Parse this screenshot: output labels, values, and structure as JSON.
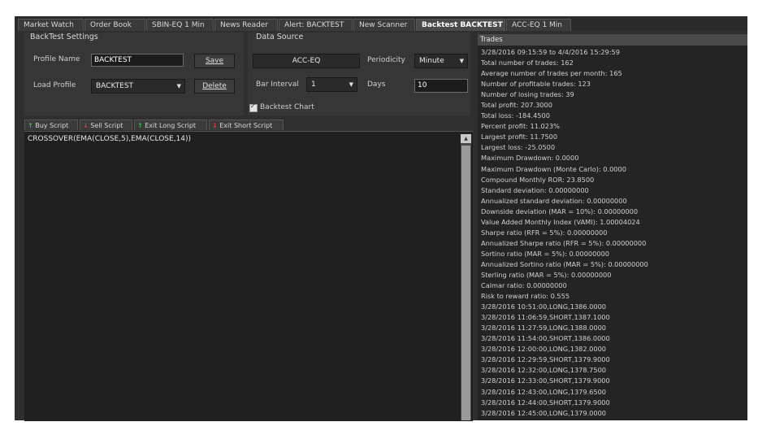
{
  "tabs": [
    {
      "label": "Market Watch"
    },
    {
      "label": "Order Book"
    },
    {
      "label": "SBIN-EQ 1 Min"
    },
    {
      "label": "News Reader"
    },
    {
      "label": "Alert: BACKTEST"
    },
    {
      "label": "New Scanner"
    },
    {
      "label": "Backtest BACKTEST",
      "close": "✕",
      "active": true
    },
    {
      "label": "ACC-EQ 1 Min"
    }
  ],
  "backtest_settings": {
    "title": "BackTest Settings",
    "profile_name_label": "Profile Name",
    "profile_name_value": "BACKTEST",
    "save_label": "Save",
    "load_profile_label": "Load Profile",
    "load_profile_value": "BACKTEST",
    "delete_label": "Delete"
  },
  "data_source": {
    "title": "Data Source",
    "symbol": "ACC-EQ",
    "periodicity_label": "Periodicity",
    "periodicity_value": "Minute",
    "bar_interval_label": "Bar Interval",
    "bar_interval_value": "1",
    "days_label": "Days",
    "days_value": "10",
    "backtest_chart_label": "Backtest Chart",
    "backtest_chart_checked": true
  },
  "script_tabs": [
    {
      "label": "Buy Script",
      "arrow": "↑",
      "arrow_color": "green"
    },
    {
      "label": "Sell Script",
      "arrow": "↓",
      "arrow_color": "red"
    },
    {
      "label": "Exit Long Script",
      "arrow": "↑",
      "arrow_color": "green"
    },
    {
      "label": "Exit Short Script",
      "arrow": "↓",
      "arrow_color": "red"
    }
  ],
  "script_code": "CROSSOVER(EMA(CLOSE,5),EMA(CLOSE,14))",
  "trades": {
    "header": "Trades",
    "lines": [
      "3/28/2016 09:15:59 to 4/4/2016 15:29:59",
      "Total number of trades: 162",
      "Average number of trades per month: 165",
      "Number of profitable trades: 123",
      "Number of losing trades: 39",
      "Total profit: 207.3000",
      "Total loss: -184.4500",
      "Percent profit: 11.023%",
      "Largest profit: 11.7500",
      "Largest loss: -25.0500",
      "Maximum Drawdown: 0.0000",
      "Maximum Drawdown (Monte Carlo): 0.0000",
      "Compound Monthly ROR: 23.8500",
      "Standard deviation: 0.00000000",
      "Annualized standard deviation: 0.00000000",
      "Downside deviation (MAR = 10%): 0.00000000",
      "Value Added Monthly Index (VAMI): 1.00004024",
      "Sharpe ratio (RFR = 5%): 0.00000000",
      "Annualized Sharpe ratio (RFR = 5%): 0.00000000",
      "Sortino ratio (MAR = 5%): 0.00000000",
      "Annualized Sortino ratio (MAR = 5%): 0.00000000",
      "Sterling ratio (MAR = 5%): 0.00000000",
      "Calmar ratio: 0.00000000",
      "Risk to reward ratio: 0.555",
      "3/28/2016 10:51:00,LONG,1386.0000",
      "3/28/2016 11:06:59,SHORT,1387.1000",
      "3/28/2016 11:27:59,LONG,1388.0000",
      "3/28/2016 11:54:00,SHORT,1386.0000",
      "3/28/2016 12:00:00,LONG,1382.0000",
      "3/28/2016 12:29:59,SHORT,1379.9000",
      "3/28/2016 12:32:00,LONG,1378.7500",
      "3/28/2016 12:33:00,SHORT,1379.9000",
      "3/28/2016 12:43:00,LONG,1379.6500",
      "3/28/2016 12:44:00,SHORT,1379.9000",
      "3/28/2016 12:45:00,LONG,1379.0000"
    ]
  },
  "colors": {
    "background": "#2f2f2f",
    "panel": "#363636",
    "buy_arrow": "#3cc33c",
    "sell_arrow": "#e23a3a"
  }
}
